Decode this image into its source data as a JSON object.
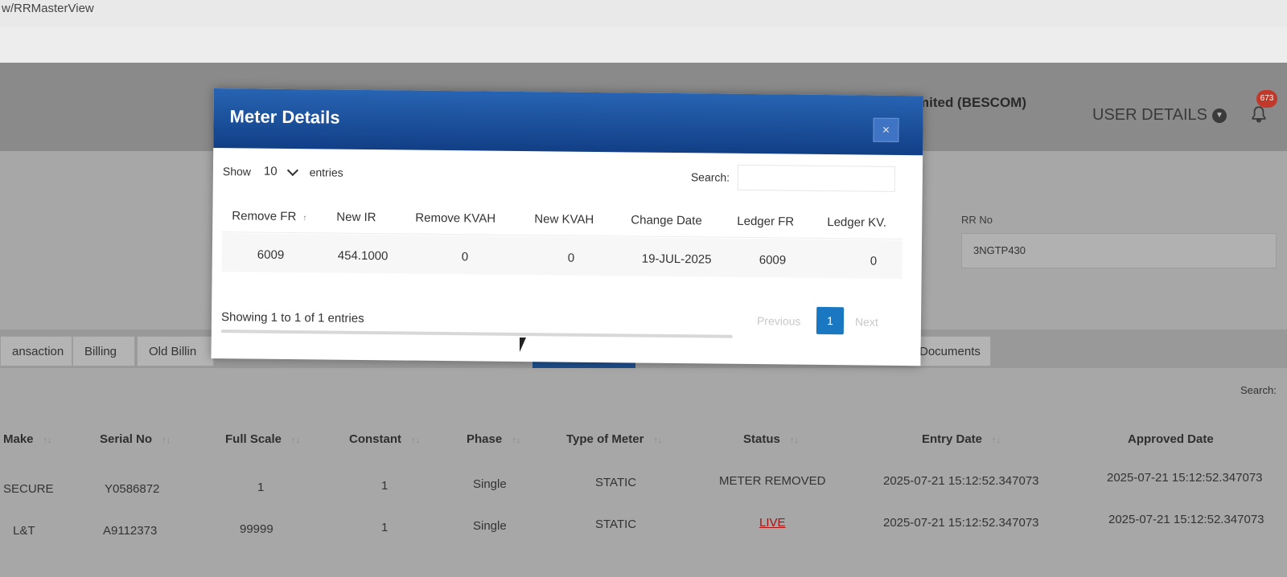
{
  "browser": {
    "url_fragment": "w/RRMasterView"
  },
  "header": {
    "org_title": "mited (BESCOM)",
    "user_details_label": "USER DETAILS",
    "notification_count": "673"
  },
  "rr": {
    "label": "RR No",
    "value": "3NGTP430"
  },
  "tabs": [
    {
      "label": "ansaction"
    },
    {
      "label": "Billing"
    },
    {
      "label": "Old Billin"
    },
    {
      "label": "Documents"
    }
  ],
  "background_table": {
    "search_label": "Search:",
    "headers": [
      "Make",
      "Serial No",
      "Full Scale",
      "Constant",
      "Phase",
      "Type of Meter",
      "Status",
      "Entry Date",
      "Approved Date"
    ],
    "rows": [
      {
        "make": "SECURE",
        "serial": "Y0586872",
        "full_scale": "1",
        "constant": "1",
        "phase": "Single",
        "type": "STATIC",
        "status": "METER REMOVED",
        "entry": "2025-07-21 15:12:52.347073",
        "approved": "2025-07-21 15:12:52.347073"
      },
      {
        "make": "L&T",
        "serial": "A9112373",
        "full_scale": "99999",
        "constant": "1",
        "phase": "Single",
        "type": "STATIC",
        "status": "LIVE",
        "entry": "2025-07-21 15:12:52.347073",
        "approved": "2025-07-21 15:12:52.347073"
      }
    ]
  },
  "modal": {
    "title": "Meter Details",
    "close_label": "×",
    "show_label": "Show",
    "entries_value": "10",
    "entries_label": "entries",
    "search_label": "Search:",
    "columns": [
      "Remove FR",
      "New IR",
      "Remove KVAH",
      "New KVAH",
      "Change Date",
      "Ledger FR",
      "Ledger KV."
    ],
    "rows": [
      {
        "remove_fr": "6009",
        "new_ir": "454.1000",
        "remove_kvah": "0",
        "new_kvah": "0",
        "change_date": "19-JUL-2025",
        "ledger_fr": "6009",
        "ledger_kv": "0"
      }
    ],
    "info": "Showing 1 to 1 of 1 entries",
    "pagination": {
      "previous": "Previous",
      "current": "1",
      "next": "Next"
    }
  }
}
